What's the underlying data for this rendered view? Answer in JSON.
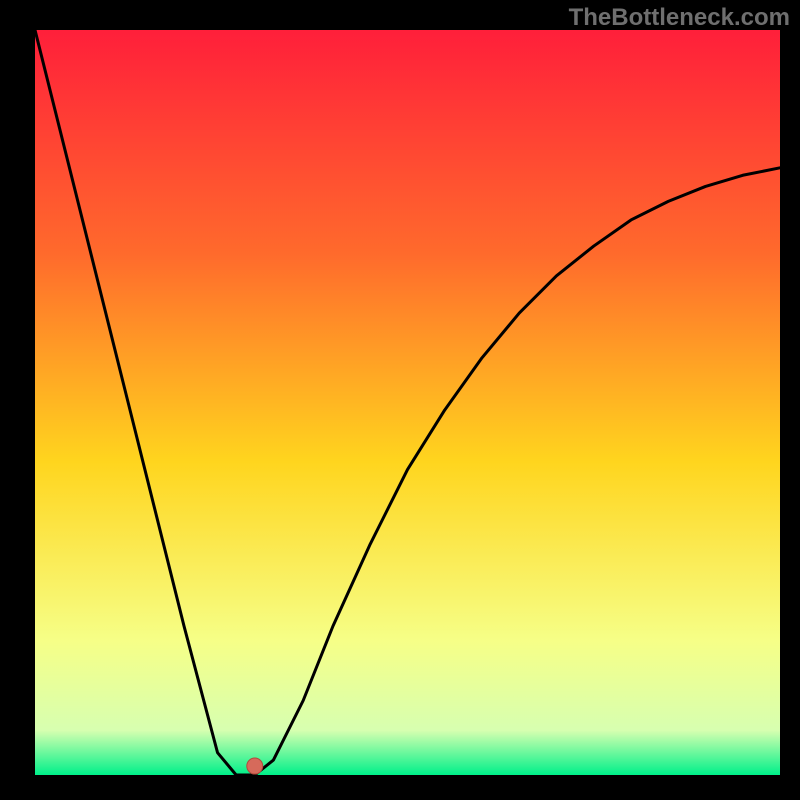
{
  "watermark": "TheBottleneck.com",
  "colors": {
    "top": "#ff1f3a",
    "q1": "#ff6a2c",
    "mid": "#ffd51e",
    "q3": "#f6ff87",
    "bottom_band": "#d7ffb0",
    "bottom_edge": "#00f08a",
    "curve": "#000000",
    "marker_fill": "#d66a5b",
    "marker_stroke": "#b24a3c",
    "frame": "#000000"
  },
  "plot": {
    "inner_x": 35,
    "inner_y": 30,
    "inner_w": 745,
    "inner_h": 745
  },
  "marker": {
    "x_frac": 0.295,
    "y_frac": 0.988,
    "r": 8
  },
  "chart_data": {
    "type": "line",
    "title": "",
    "xlabel": "",
    "ylabel": "",
    "xlim": [
      0,
      1
    ],
    "ylim": [
      0,
      1
    ],
    "grid": false,
    "legend": false,
    "series": [
      {
        "name": "curve",
        "x": [
          0.0,
          0.05,
          0.1,
          0.15,
          0.2,
          0.245,
          0.27,
          0.295,
          0.32,
          0.36,
          0.4,
          0.45,
          0.5,
          0.55,
          0.6,
          0.65,
          0.7,
          0.75,
          0.8,
          0.85,
          0.9,
          0.95,
          1.0
        ],
        "y": [
          1.0,
          0.8,
          0.6,
          0.4,
          0.2,
          0.03,
          0.0,
          0.0,
          0.02,
          0.1,
          0.2,
          0.31,
          0.41,
          0.49,
          0.56,
          0.62,
          0.67,
          0.71,
          0.745,
          0.77,
          0.79,
          0.805,
          0.815
        ]
      }
    ],
    "marker_point": {
      "x": 0.295,
      "y": 0.012
    },
    "background_gradient_stops": [
      {
        "offset": 0.0,
        "color": "#ff1f3a"
      },
      {
        "offset": 0.3,
        "color": "#ff6a2c"
      },
      {
        "offset": 0.58,
        "color": "#ffd51e"
      },
      {
        "offset": 0.82,
        "color": "#f6ff87"
      },
      {
        "offset": 0.94,
        "color": "#d7ffb0"
      },
      {
        "offset": 1.0,
        "color": "#00f08a"
      }
    ]
  }
}
